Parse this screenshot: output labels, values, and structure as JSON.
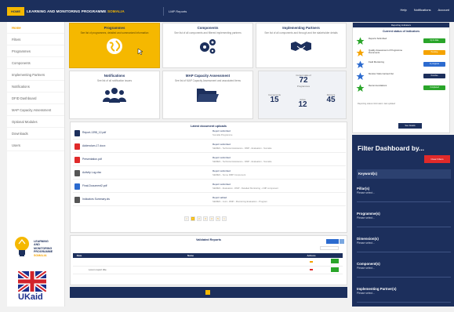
{
  "topbar": {
    "home_label": "HOME",
    "title_main": "LEARNING AND MONITORING PROGRAMME",
    "title_highlight": "SOMALIA",
    "reports_label": "LMP Reports",
    "right_items": [
      "Help",
      "Notifications",
      "Account"
    ]
  },
  "sidebar": {
    "items": [
      "Home",
      "Filters",
      "Programmes",
      "Components",
      "Implementing Partners",
      "Notifications",
      "DFID Dashboard",
      "MAP Capacity Assessment",
      "Optional Modules",
      "Downloads",
      "Users"
    ],
    "logo_text": [
      "LEARNING",
      "AND",
      "MONITORING",
      "PROGRAMME",
      "SOMALIA"
    ],
    "ukaid_text": "UKaid"
  },
  "cards": [
    {
      "title": "Programmes",
      "desc": "See list of programmes, detailed and summarized information"
    },
    {
      "title": "Components",
      "desc": "See list of all components and filtered implementing partners"
    },
    {
      "title": "Implementing Partners",
      "desc": "See list of all components and through and the stakeholder details"
    },
    {
      "title": "Notifications",
      "desc": "See list of all notification issues"
    },
    {
      "title": "MAP Capacity Assessment",
      "desc": "See list of MAP Capacity Assessment and associated items"
    }
  ],
  "stats": {
    "top_label": "Current state of",
    "top_value": "72",
    "top_sub": "Programmes",
    "items": [
      {
        "label": "Components",
        "value": "15"
      },
      {
        "label": "Active",
        "value": "12"
      },
      {
        "label": "Partners",
        "value": "45"
      }
    ]
  },
  "updates": {
    "title": "Latest document uploads",
    "files": [
      {
        "name": "Report-1398_12.pdf",
        "color": "#1c2f5c"
      },
      {
        "name": "Addendum-17.docx",
        "color": "#e02a2a"
      },
      {
        "name": "Presentation.pdf",
        "color": "#e02a2a"
      },
      {
        "name": "Activity Log.xlsx",
        "color": "#555555"
      },
      {
        "name": "Final-Document2.pdf",
        "color": "#2c6bcf"
      },
      {
        "name": "Indicators Summary.xls",
        "color": "#555555"
      }
    ],
    "right": [
      {
        "t": "Report submitted",
        "d": "Somalia Programme"
      },
      {
        "t": "Report submitted",
        "d": "SERIES - Technical Assistance - DMP - Evaluation - Somalia"
      },
      {
        "t": "Report submitted",
        "d": "SERIES - Technical Assistance - DMP - Evaluation - Somalia"
      },
      {
        "t": "Report submitted",
        "d": "SERIES - Some DMP Component"
      },
      {
        "t": "Report submitted",
        "d": "SERIES - Evaluation - DMP - Detailed Monitoring - LMP component"
      },
      {
        "t": "Report added",
        "d": "SERIES - Joint - DMP - Monitoring Evaluation - Program"
      }
    ],
    "pages": [
      "<",
      "1",
      "2",
      "3",
      "4",
      "5",
      ">"
    ]
  },
  "reports": {
    "title": "Validated Reports",
    "headers": [
      "Date",
      "Name",
      "Actions"
    ],
    "rows": [
      {
        "date": "",
        "name": "",
        "action": "View"
      },
      {
        "date": "",
        "name": "Lorem report title",
        "action": "View"
      }
    ]
  },
  "rightpanel": {
    "header": "Reporting Indicators",
    "title": "Current status of indicators",
    "indicators": [
      {
        "label": "Reports Submitted",
        "pill": "Up to date",
        "color": "#2aa52a",
        "icon": "star-icon",
        "icon_color": "#2aa52a"
      },
      {
        "label": "Quality Assessment of Programme Documents",
        "pill": "Pending",
        "color": "#f5a300",
        "icon": "recycle-icon",
        "icon_color": "#f5a300"
      },
      {
        "label": "Field Monitoring",
        "pill": "In progress",
        "color": "#2c6bcf",
        "icon": "pin-icon",
        "icon_color": "#2c6bcf"
      },
      {
        "label": "Monitor Visits Carried Out",
        "pill": "Overdue",
        "color": "#1c2f5c",
        "icon": "person-icon",
        "icon_color": "#2c6bcf"
      },
      {
        "label": "Recommendations",
        "pill": "Completed",
        "color": "#2aa52a",
        "icon": "cycle-icon",
        "icon_color": "#2aa52a"
      }
    ],
    "note": "Reporting status information: last updated",
    "button": "See Details"
  },
  "filter": {
    "title": "Filter Dashboard by...",
    "clear": "Clear Filters",
    "keyword": "Keyword(s)",
    "fields": [
      {
        "label": "Pillar(s)",
        "value": "Please select..."
      },
      {
        "label": "Programme(s)",
        "value": "Please select..."
      },
      {
        "label": "Dimension(s)",
        "value": "Please select..."
      },
      {
        "label": "Component(s)",
        "value": "Please select..."
      },
      {
        "label": "Implementing Partner(s)",
        "value": "Please select..."
      }
    ]
  }
}
